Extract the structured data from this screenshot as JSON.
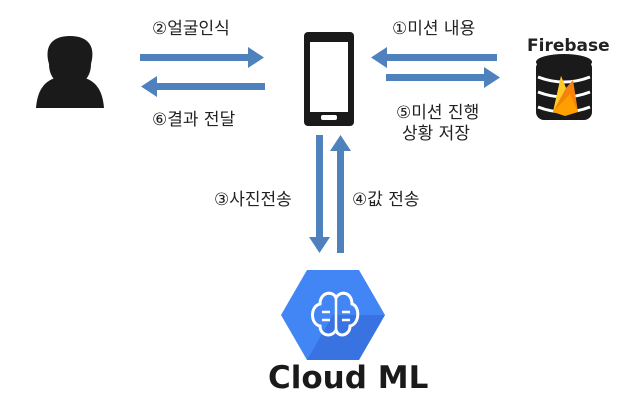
{
  "nodes": {
    "user": {
      "icon": "person-icon"
    },
    "phone": {
      "icon": "smartphone-icon"
    },
    "firebase": {
      "label": "Firebase",
      "icon": "firebase-database-icon"
    },
    "cloud_ml": {
      "label": "Cloud ML",
      "icon": "cloud-ml-brain-icon"
    }
  },
  "flows": {
    "step1": "①미션 내용",
    "step2": "②얼굴인식",
    "step3": "③사진전송",
    "step4": "④값 전송",
    "step5_line1": "⑤미션 진행",
    "step5_line2": "상황 저장",
    "step6": "⑥결과 전달"
  },
  "colors": {
    "arrow": "#4f81bd",
    "icon_dark": "#1a1a1a",
    "cloud_ml_blue": "#4285f4",
    "cloud_ml_dark_blue": "#3367d6",
    "firebase_orange": "#f5820d",
    "firebase_yellow": "#ffca28"
  }
}
